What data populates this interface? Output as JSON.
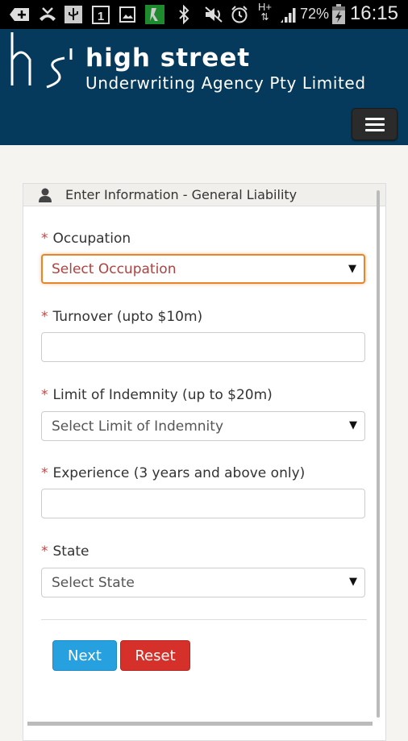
{
  "status_bar": {
    "icons": [
      "add-icon",
      "missed-call-icon",
      "usb-icon",
      "calendar-icon",
      "image-icon",
      "sports-app-icon",
      "bluetooth-icon",
      "mute-icon",
      "alarm-icon",
      "hplus-data-icon",
      "signal-icon",
      "battery-charging-icon"
    ],
    "calendar_day": "1",
    "network_type": "H+",
    "battery": "72%",
    "time": "16:15"
  },
  "header": {
    "brand_title": "high street",
    "brand_subtitle": "Underwriting Agency Pty Limited",
    "menu_icon": "hamburger-icon"
  },
  "form": {
    "title": "Enter Information - General Liability",
    "title_icon": "user-icon",
    "required_marker": "*",
    "fields": [
      {
        "label": "Occupation",
        "type": "select",
        "value": "Select Occupation"
      },
      {
        "label": "Turnover (upto $10m)",
        "type": "input",
        "value": ""
      },
      {
        "label": "Limit of Indemnity (up to $20m)",
        "type": "select",
        "value": "Select Limit of Indemnity"
      },
      {
        "label": "Experience (3 years and above only)",
        "type": "input",
        "value": ""
      },
      {
        "label": "State",
        "type": "select",
        "value": "Select State"
      }
    ],
    "buttons": {
      "next": "Next",
      "reset": "Reset"
    }
  },
  "colors": {
    "header_bg": "#053a5c",
    "next_button": "#26a0de",
    "reset_button": "#d6302a",
    "focus_border": "#e8852a",
    "required": "#d43f3a"
  }
}
